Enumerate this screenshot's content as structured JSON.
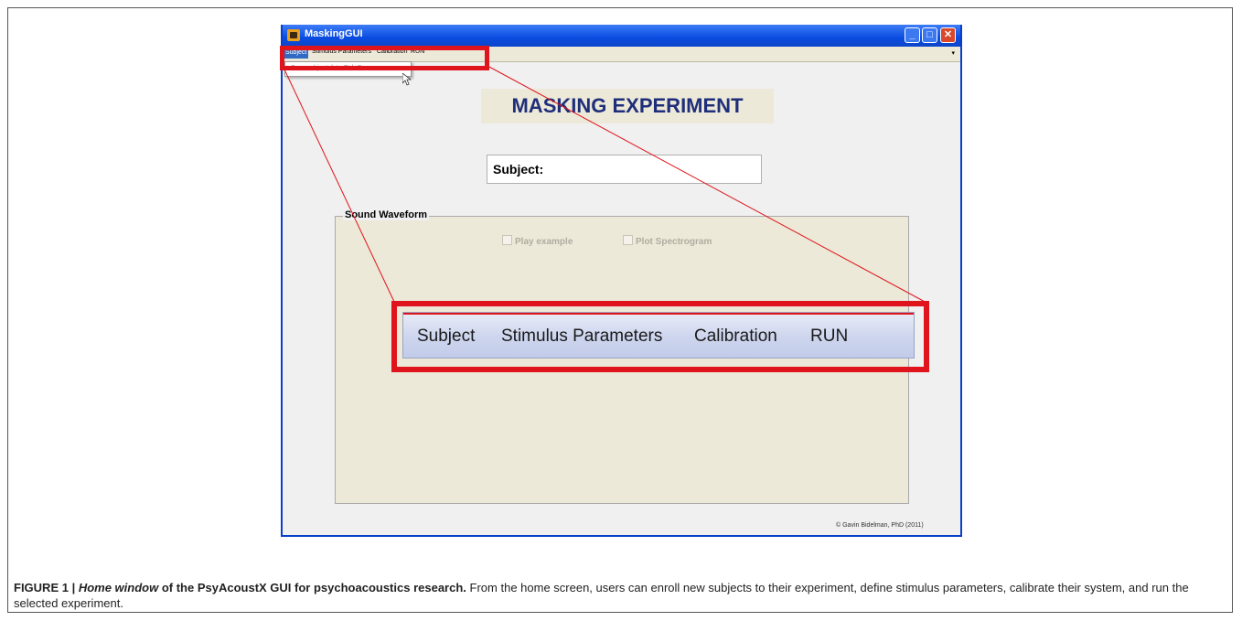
{
  "window": {
    "title": "MaskingGUI",
    "controls": {
      "minimize": "_",
      "maximize": "□",
      "close": "✕"
    },
    "menu": [
      "Subject",
      "Stimulus Parameters",
      "Calibration",
      "RUN"
    ],
    "dropdown_item": "Save subject data  Ctrl+S",
    "heading": "MASKING EXPERIMENT",
    "subject_label": "Subject:",
    "group_title": "Sound Waveform",
    "checkbox_play": "Play example",
    "checkbox_spectrogram": "Plot Spectrogram",
    "copyright": "© Gavin Bidelman, PhD (2011)"
  },
  "zoom_menu": [
    "Subject",
    "Stimulus Parameters",
    "Calibration",
    "RUN"
  ],
  "caption": {
    "label": "FIGURE 1 |",
    "title_italic": "Home window",
    "title_rest": "of the PsyAcoustX GUI for psychoacoustics research.",
    "body": "From the home screen, users can enroll new subjects to their experiment, define stimulus parameters, calibrate their system, and run the selected experiment."
  },
  "colors": {
    "highlight": "#e0141c",
    "title_text": "#1f2e7a"
  }
}
